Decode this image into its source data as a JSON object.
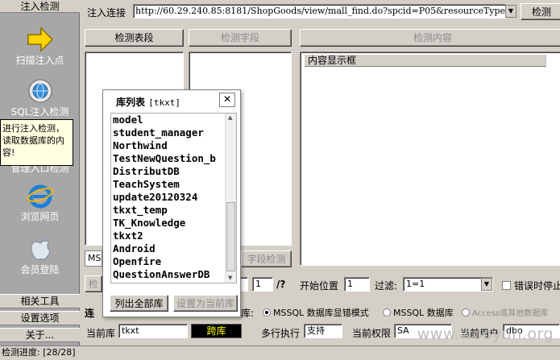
{
  "sidebar": {
    "header": "注入检测",
    "items": [
      {
        "label": "扫描注入点",
        "icon": "arrow-right-icon"
      },
      {
        "label": "SQL注入检测",
        "icon": "gear-globe-icon"
      },
      {
        "label": "管理入口检测",
        "icon": "search-icon"
      },
      {
        "label": "浏览网页",
        "icon": "ie-browser-icon"
      },
      {
        "label": "会员登陆",
        "icon": "apple-icon"
      }
    ],
    "tooltip": "进行注入检测，读取数据库的内容!",
    "bottom_buttons": [
      "相关工具",
      "设置选项",
      "关于..."
    ]
  },
  "toolbar": {
    "url_label": "注入连接",
    "url_value": "http://60.29.240.85:8181/ShopGoods/view/mall_find.do?spcid=P05&resourceTypeI",
    "check_button": "检测"
  },
  "panels": {
    "detect_table_button": "检测表段",
    "detect_field_button": "检测字段",
    "detect_content_button": "检测内容",
    "content_header": "内容显示框",
    "field_detect_button_partial": "字段检测",
    "combo_partial": "MS",
    "check_partial": "检"
  },
  "dialog": {
    "title": "库列表",
    "title_tag": "[tkxt]",
    "close": "✕",
    "items": [
      "model",
      "student_manager",
      "Northwind",
      "TestNewQuestion_b",
      "DistributDB",
      "TeachSystem",
      "update20120324",
      "tkxt_temp",
      "TK_Knowledge",
      "tkxt2",
      "Android",
      "Openfire",
      "QuestionAnswerDB"
    ],
    "list_all_button": "列出全部库",
    "set_current_button": "设置为当前库"
  },
  "controls": {
    "page_value": "1",
    "page_suffix": "/?",
    "start_pos_label": "开始位置",
    "start_pos_value": "1",
    "filter_label": "过滤:",
    "filter_value": "1=1",
    "stop_on_error": "错误时停止",
    "conn_label_partial": "连",
    "db_type_label": "库:",
    "radio_mssql_error": "MSSQL 数据库显错模式",
    "radio_mssql": "MSSQL 数据库",
    "radio_access": "Access或其他数据库",
    "current_db_label": "当前库",
    "current_db_value": "tkxt",
    "cross_db_button": "跨库",
    "multi_exec_label": "多行执行",
    "multi_exec_value": "支持",
    "current_perm_label": "当前权限",
    "current_perm_value": "SA",
    "current_user_label": "当前用户",
    "current_user_value": "dbo"
  },
  "status": {
    "text": "检测进度: [28/28]"
  },
  "watermark": "www.wooyun.org",
  "colors": {
    "sidebar_bg": "#a7a7a7",
    "tooltip_bg": "#ffffe1",
    "cross_db_bg": "#000000",
    "cross_db_fg": "#ffff00"
  }
}
